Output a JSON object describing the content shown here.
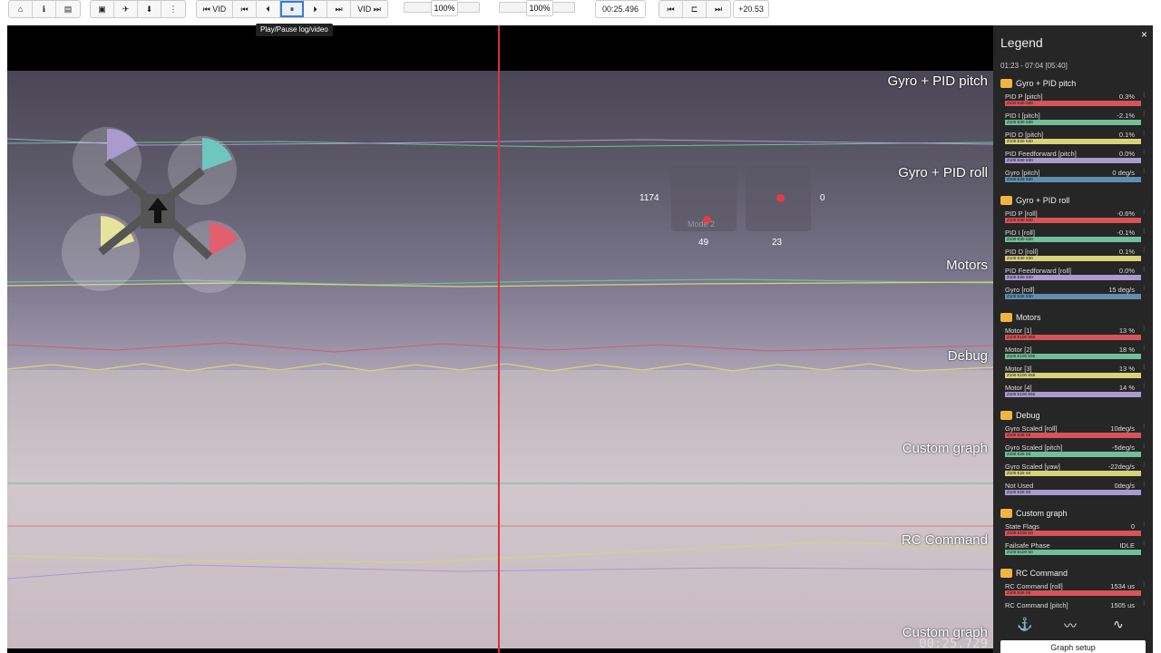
{
  "toolbar": {
    "group1": [
      "⌂",
      "ℹ",
      "▤"
    ],
    "group2": [
      "▣",
      "✈",
      "⬇",
      "⋮"
    ],
    "vid_back_label": "⏮ VID",
    "nav_buttons": [
      "⏮",
      "⏴",
      "⏸",
      "⏵",
      "⏭"
    ],
    "vid_fwd_label": "VID ⏭",
    "speed_label": "100%",
    "zoom_label": "100%",
    "time_value": "00:25.496",
    "offset_value": "+20.53"
  },
  "tooltip": "Play/Pause log/video",
  "viewer": {
    "graph_labels": [
      "Gyro + PID pitch",
      "Gyro + PID roll",
      "Motors",
      "Debug",
      "Custom graph",
      "RC Command",
      "Custom graph"
    ],
    "time_readout": "00:25.729",
    "stick_left_value": "1174",
    "stick_left_bottom": "49",
    "stick_right_value": "0",
    "stick_right_bottom": "23",
    "mode_label": "Mode 2"
  },
  "legend": {
    "title": "Legend",
    "close": "×",
    "range": "01:23 - 07:04 [05:40]",
    "groups": [
      {
        "name": "Gyro + PID pitch",
        "items": [
          {
            "name": "PID P [pitch]",
            "value": "0.3%",
            "color": "#d8535a",
            "scale": "Z100 E30 S30"
          },
          {
            "name": "PID I [pitch]",
            "value": "-2.1%",
            "color": "#6fbf9a",
            "scale": "Z100 E30 S30"
          },
          {
            "name": "PID D [pitch]",
            "value": "0.1%",
            "color": "#d6d47a",
            "scale": "Z100 E30 S30"
          },
          {
            "name": "PID Feedforward [pitch]",
            "value": "0.0%",
            "color": "#a99ad0",
            "scale": "Z100 E30 S30"
          },
          {
            "name": "Gyro [pitch]",
            "value": "0 deg/s",
            "color": "#5f8fb0",
            "scale": "Z100 E25 S30"
          }
        ]
      },
      {
        "name": "Gyro + PID roll",
        "items": [
          {
            "name": "PID P [roll]",
            "value": "-0.6%",
            "color": "#d8535a",
            "scale": "Z100 E30 S30"
          },
          {
            "name": "PID I [roll]",
            "value": "-0.1%",
            "color": "#6fbf9a",
            "scale": "Z100 E30 S30"
          },
          {
            "name": "PID D [roll]",
            "value": "0.1%",
            "color": "#d6d47a",
            "scale": "Z100 E30 S30"
          },
          {
            "name": "PID Feedforward [roll]",
            "value": "0.0%",
            "color": "#a99ad0",
            "scale": "Z100 E30 S30"
          },
          {
            "name": "Gyro [roll]",
            "value": "15 deg/s",
            "color": "#5f8fb0",
            "scale": "Z100 E25 S30"
          }
        ]
      },
      {
        "name": "Motors",
        "items": [
          {
            "name": "Motor [1]",
            "value": "13 %",
            "color": "#d8535a",
            "scale": "Z100 E100 S50"
          },
          {
            "name": "Motor [2]",
            "value": "18 %",
            "color": "#6fbf9a",
            "scale": "Z100 E100 S50"
          },
          {
            "name": "Motor [3]",
            "value": "13 %",
            "color": "#d6d47a",
            "scale": "Z100 E100 S50"
          },
          {
            "name": "Motor [4]",
            "value": "14 %",
            "color": "#a99ad0",
            "scale": "Z100 E100 S50"
          }
        ]
      },
      {
        "name": "Debug",
        "items": [
          {
            "name": "Gyro Scaled [roll]",
            "value": "10deg/s",
            "color": "#d8535a",
            "scale": "Z100 E25 S0"
          },
          {
            "name": "Gyro Scaled [pitch]",
            "value": "-5deg/s",
            "color": "#6fbf9a",
            "scale": "Z100 E25 S0"
          },
          {
            "name": "Gyro Scaled [yaw]",
            "value": "-22deg/s",
            "color": "#d6d47a",
            "scale": "Z100 E25 S0"
          },
          {
            "name": "Not Used",
            "value": "0deg/s",
            "color": "#a99ad0",
            "scale": "Z100 E25 S0"
          }
        ]
      },
      {
        "name": "Custom graph",
        "items": [
          {
            "name": "State Flags",
            "value": "0",
            "color": "#d8535a",
            "scale": "Z100 E100 S0"
          },
          {
            "name": "Failsafe Phase",
            "value": "IDLE",
            "color": "#6fbf9a",
            "scale": "Z100 E100 S0"
          }
        ]
      },
      {
        "name": "RC Command",
        "items": [
          {
            "name": "RC Command [roll]",
            "value": "1534 us",
            "color": "#d8535a",
            "scale": "Z100 E25 S0"
          },
          {
            "name": "RC Command [pitch]",
            "value": "1505 us",
            "color": "#6fbf9a",
            "scale": "Z100 E25 S0"
          }
        ]
      }
    ],
    "footer_icons": [
      "⚓",
      "〰",
      "∿"
    ],
    "graph_setup": "Graph setup"
  },
  "colors": {
    "accent": "#3a7bd5",
    "cursor": "#d9343b",
    "legend_toggle": "#f0b442"
  }
}
